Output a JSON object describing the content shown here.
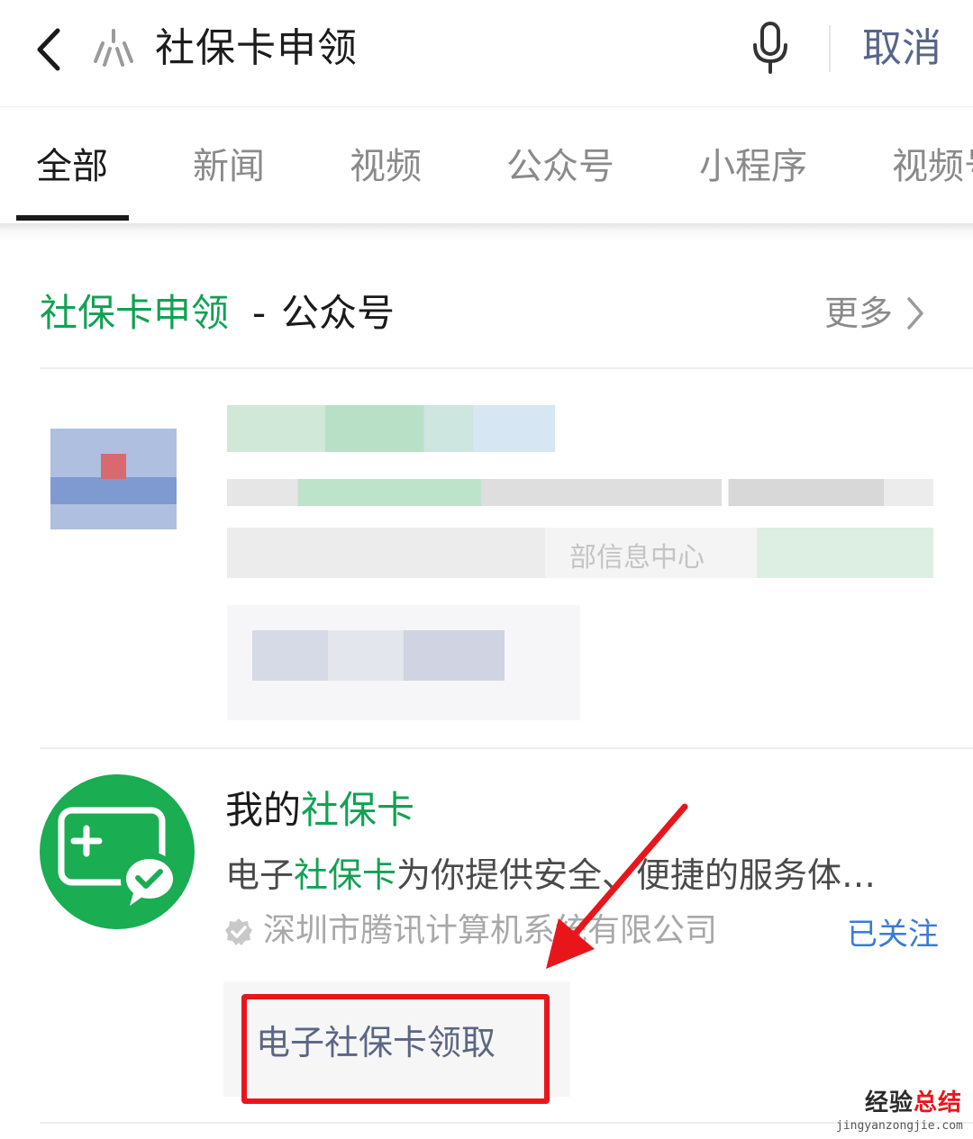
{
  "search": {
    "query": "社保卡申领",
    "cancel_label": "取消"
  },
  "tabs": [
    {
      "label": "全部",
      "active": true
    },
    {
      "label": "新闻",
      "active": false
    },
    {
      "label": "视频",
      "active": false
    },
    {
      "label": "公众号",
      "active": false
    },
    {
      "label": "小程序",
      "active": false
    },
    {
      "label": "视频号",
      "active": false
    }
  ],
  "section": {
    "keyword": "社保卡申领",
    "separator": "-",
    "type": "公众号",
    "more_label": "更多"
  },
  "account": {
    "title_prefix": "我的",
    "title_keyword": "社保卡",
    "desc_prefix": "电子",
    "desc_keyword": "社保卡",
    "desc_rest": "为你提供安全、便捷的服务体…",
    "company": "深圳市腾讯计算机系统有限公司",
    "follow_status": "已关注",
    "service_link": "电子社保卡领取"
  },
  "blurred_fragment": "部信息中心",
  "watermark": {
    "main_a": "经验",
    "main_b": "总结",
    "sub": "jingyanzongjie.com"
  },
  "colors": {
    "accent_green": "#12a153",
    "avatar_green": "#1aad52",
    "link_blue": "#3a7bd5",
    "cancel_blue": "#58658a",
    "annotation_red": "#e8161b"
  },
  "icons": [
    "back-chevron-icon",
    "search-icon",
    "microphone-icon",
    "chevron-right-icon",
    "verified-badge-icon",
    "card-plus-icon",
    "wechat-pay-icon"
  ]
}
